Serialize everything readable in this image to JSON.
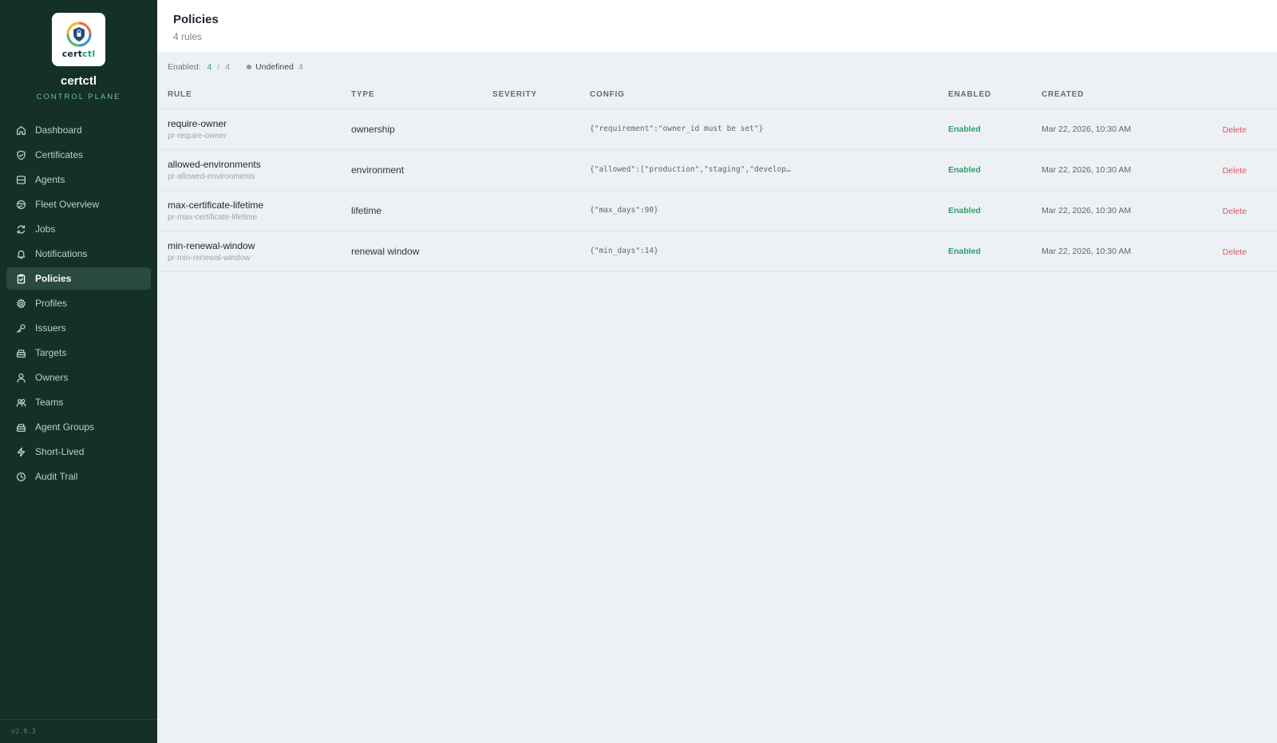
{
  "brand": {
    "logo_word_prefix": "cert",
    "logo_word_suffix": "ctl",
    "name": "certctl",
    "subtitle": "CONTROL PLANE"
  },
  "sidebar": {
    "items": [
      {
        "label": "Dashboard",
        "icon": "home-icon"
      },
      {
        "label": "Certificates",
        "icon": "shield-icon"
      },
      {
        "label": "Agents",
        "icon": "server-icon"
      },
      {
        "label": "Fleet Overview",
        "icon": "globe-icon"
      },
      {
        "label": "Jobs",
        "icon": "refresh-icon"
      },
      {
        "label": "Notifications",
        "icon": "bell-icon"
      },
      {
        "label": "Policies",
        "icon": "clipboard-check-icon",
        "active": true
      },
      {
        "label": "Profiles",
        "icon": "gear-icon"
      },
      {
        "label": "Issuers",
        "icon": "key-icon"
      },
      {
        "label": "Targets",
        "icon": "box-icon"
      },
      {
        "label": "Owners",
        "icon": "user-icon"
      },
      {
        "label": "Teams",
        "icon": "users-icon"
      },
      {
        "label": "Agent Groups",
        "icon": "layers-icon"
      },
      {
        "label": "Short-Lived",
        "icon": "lightning-icon"
      },
      {
        "label": "Audit Trail",
        "icon": "clock-icon"
      }
    ],
    "version": "v2.0.3"
  },
  "header": {
    "title": "Policies",
    "subtitle": "4 rules"
  },
  "summary": {
    "enabled_label": "Enabled:",
    "enabled_count": "4",
    "separator": "/",
    "total": "4",
    "undefined_label": "Undefined",
    "undefined_count": "4"
  },
  "table": {
    "columns": [
      "RULE",
      "TYPE",
      "SEVERITY",
      "CONFIG",
      "ENABLED",
      "CREATED"
    ],
    "rows": [
      {
        "name": "require-owner",
        "id": "pr-require-owner",
        "type": "ownership",
        "severity": "",
        "config": "{\"requirement\":\"owner_id must be set\"}",
        "enabled": "Enabled",
        "created": "Mar 22, 2026, 10:30 AM",
        "action": "Delete"
      },
      {
        "name": "allowed-environments",
        "id": "pr-allowed-environments",
        "type": "environment",
        "severity": "",
        "config": "{\"allowed\":[\"production\",\"staging\",\"develop…",
        "enabled": "Enabled",
        "created": "Mar 22, 2026, 10:30 AM",
        "action": "Delete"
      },
      {
        "name": "max-certificate-lifetime",
        "id": "pr-max-certificate-lifetime",
        "type": "lifetime",
        "severity": "",
        "config": "{\"max_days\":90}",
        "enabled": "Enabled",
        "created": "Mar 22, 2026, 10:30 AM",
        "action": "Delete"
      },
      {
        "name": "min-renewal-window",
        "id": "pr-min-renewal-window",
        "type": "renewal window",
        "severity": "",
        "config": "{\"min_days\":14}",
        "enabled": "Enabled",
        "created": "Mar 22, 2026, 10:30 AM",
        "action": "Delete"
      }
    ]
  },
  "colors": {
    "sidebar_bg": "#143027",
    "accent": "#2e9e6a",
    "danger": "#e05555"
  }
}
